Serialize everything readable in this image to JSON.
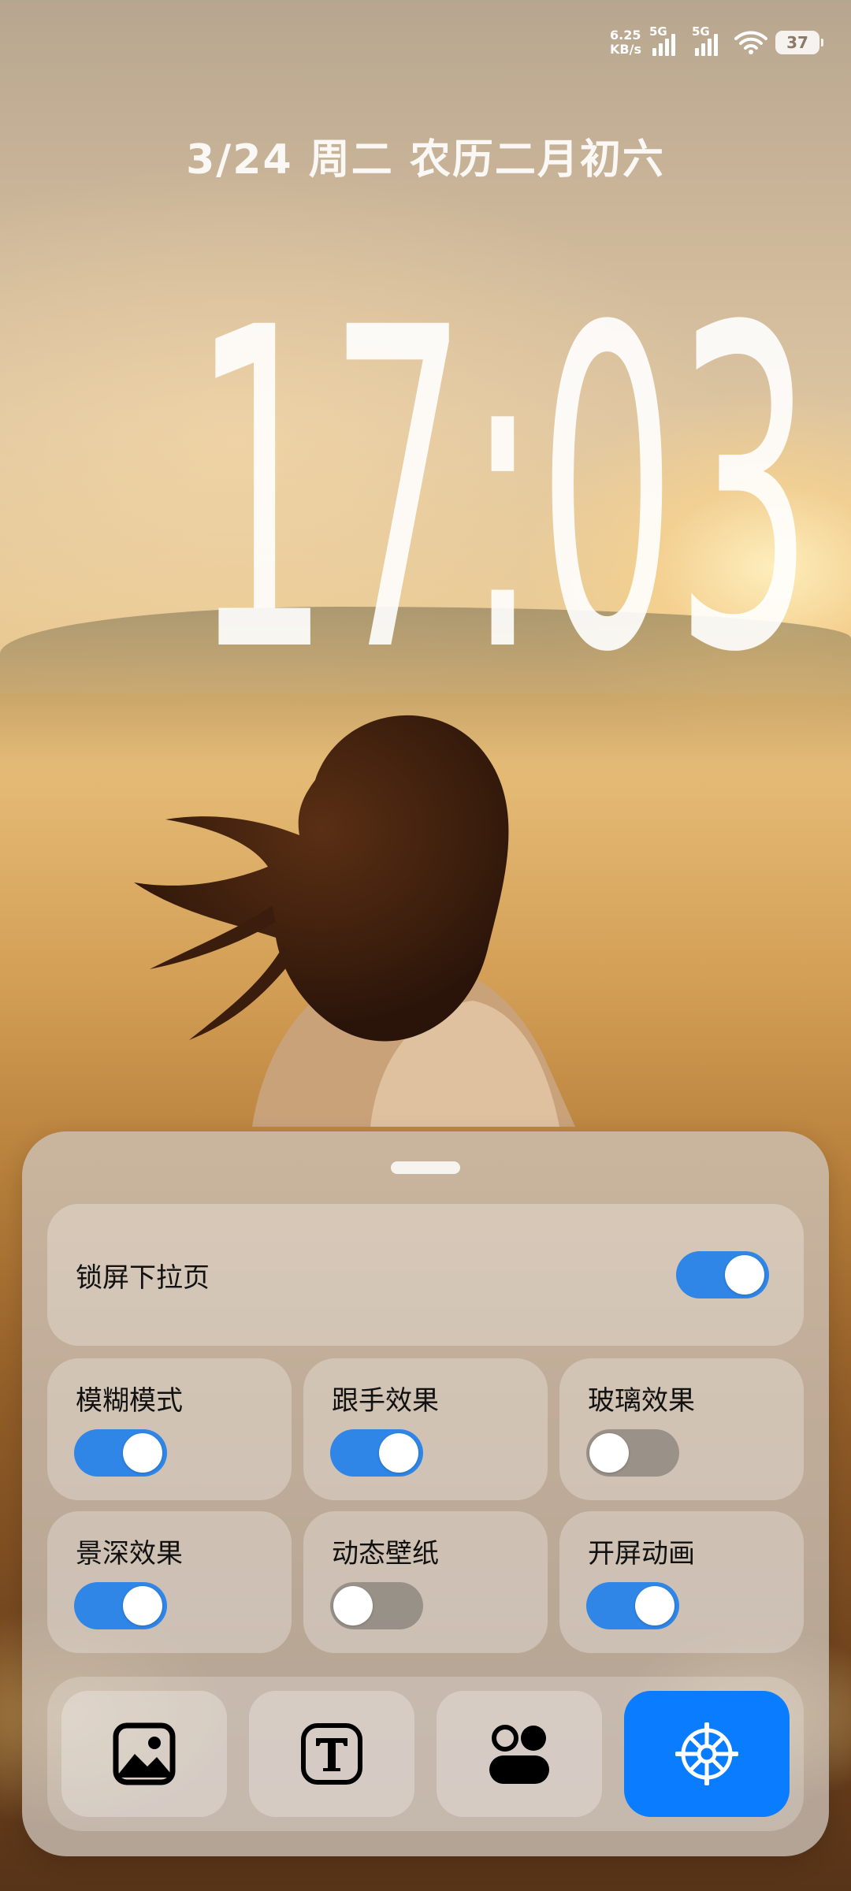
{
  "status_bar": {
    "net_speed_value": "6.25",
    "net_speed_unit": "KB/s",
    "sim1_label": "5G",
    "sim2_label": "5G",
    "battery": "37",
    "icons": [
      "signal-icon",
      "signal-icon",
      "wifi-icon",
      "battery-icon"
    ]
  },
  "lock_screen": {
    "date": "3/24 周二 农历二月初六",
    "time": "17:03"
  },
  "panel": {
    "main_toggle": {
      "label": "锁屏下拉页",
      "on": true
    },
    "toggles": [
      {
        "label": "模糊模式",
        "on": true
      },
      {
        "label": "跟手效果",
        "on": true
      },
      {
        "label": "玻璃效果",
        "on": false
      },
      {
        "label": "景深效果",
        "on": true
      },
      {
        "label": "动态壁纸",
        "on": false
      },
      {
        "label": "开屏动画",
        "on": true
      }
    ],
    "dock": [
      {
        "icon": "image-icon",
        "active": false
      },
      {
        "icon": "text-style-icon",
        "active": false
      },
      {
        "icon": "widgets-icon",
        "active": false
      },
      {
        "icon": "settings-gear-icon",
        "active": true
      }
    ]
  },
  "colors": {
    "accent": "#2f86e6",
    "active_dock": "#0a7cff"
  }
}
